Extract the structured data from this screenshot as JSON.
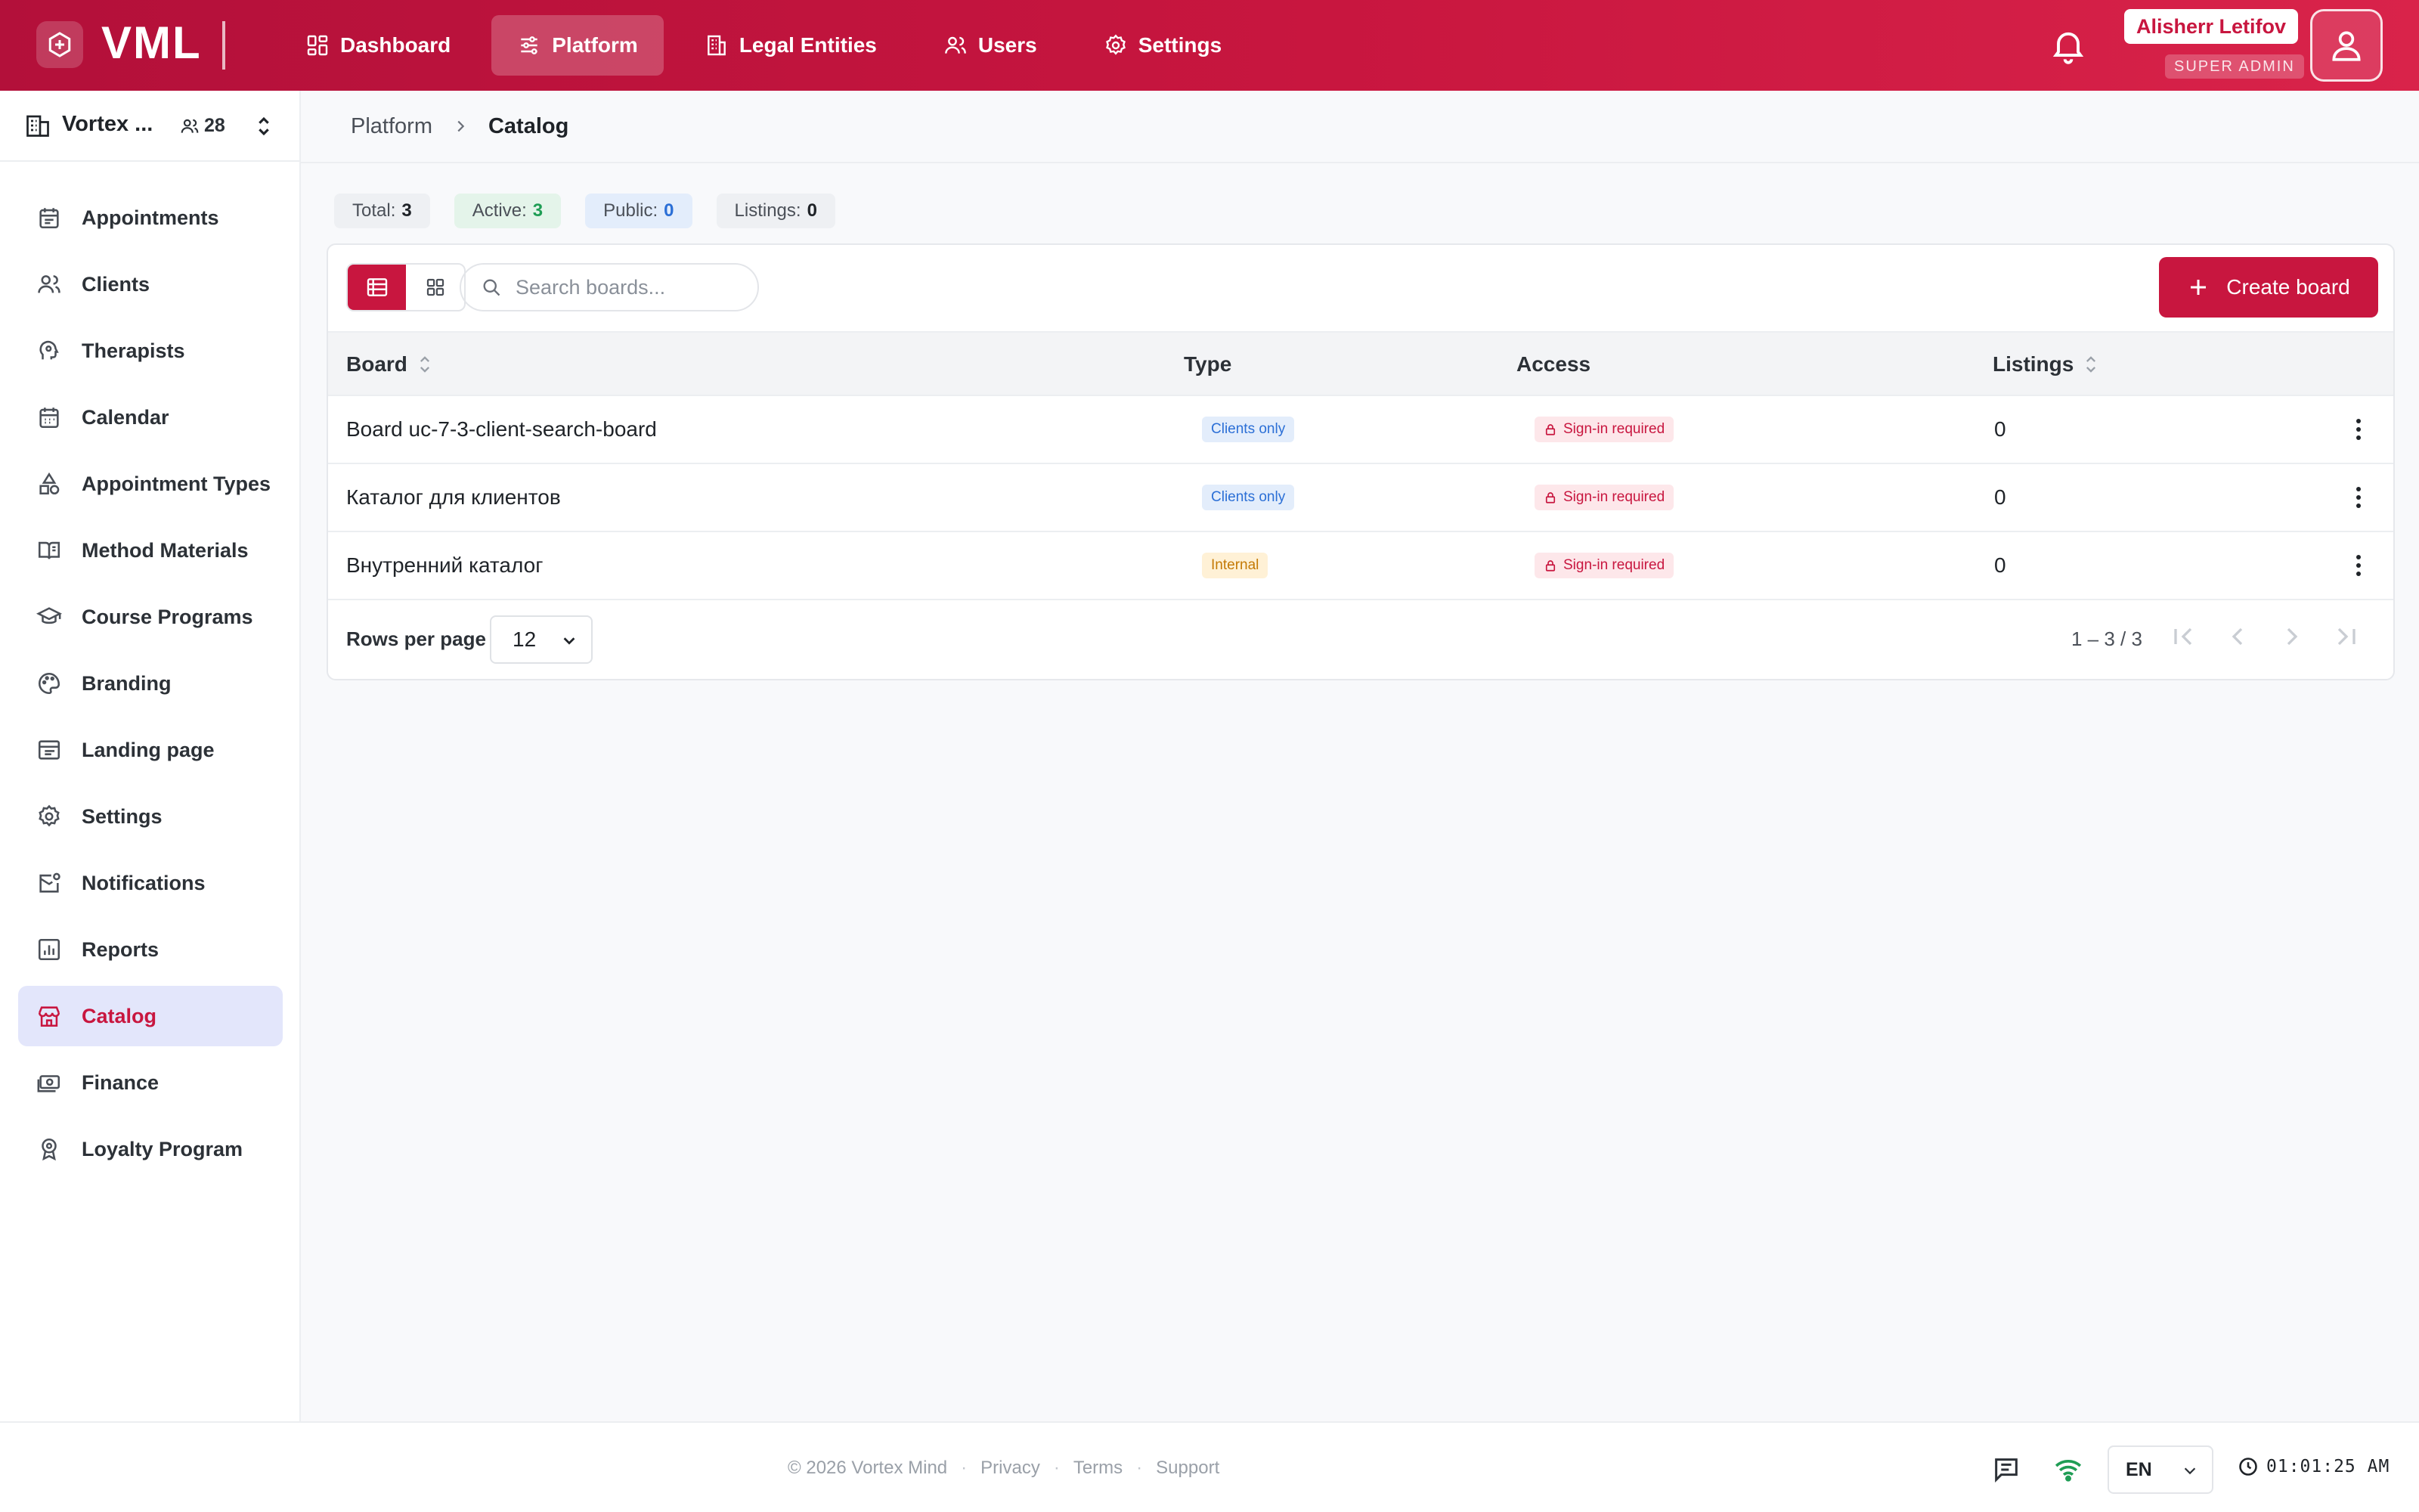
{
  "app": {
    "logo_text": "VML"
  },
  "nav": [
    {
      "label": "Dashboard",
      "icon": "dashboard-icon",
      "active": false
    },
    {
      "label": "Platform",
      "icon": "sliders-icon",
      "active": true
    },
    {
      "label": "Legal Entities",
      "icon": "building-icon",
      "active": false
    },
    {
      "label": "Users",
      "icon": "users-icon",
      "active": false
    },
    {
      "label": "Settings",
      "icon": "gear-icon",
      "active": false
    }
  ],
  "user": {
    "name": "Alisherr Letifov",
    "role": "SUPER ADMIN"
  },
  "org": {
    "name": "Vortex ...",
    "member_count": "28"
  },
  "sidebar": {
    "items": [
      {
        "label": "Appointments",
        "icon": "calendar-list-icon",
        "active": false
      },
      {
        "label": "Clients",
        "icon": "users-icon",
        "active": false
      },
      {
        "label": "Therapists",
        "icon": "head-icon",
        "active": false
      },
      {
        "label": "Calendar",
        "icon": "calendar-icon",
        "active": false
      },
      {
        "label": "Appointment Types",
        "icon": "shapes-icon",
        "active": false
      },
      {
        "label": "Method Materials",
        "icon": "book-icon",
        "active": false
      },
      {
        "label": "Course Programs",
        "icon": "graduation-cap-icon",
        "active": false
      },
      {
        "label": "Branding",
        "icon": "palette-icon",
        "active": false
      },
      {
        "label": "Landing page",
        "icon": "layout-icon",
        "active": false
      },
      {
        "label": "Settings",
        "icon": "gear-icon",
        "active": false
      },
      {
        "label": "Notifications",
        "icon": "mail-bell-icon",
        "active": false
      },
      {
        "label": "Reports",
        "icon": "bar-chart-icon",
        "active": false
      },
      {
        "label": "Catalog",
        "icon": "store-icon",
        "active": true
      },
      {
        "label": "Finance",
        "icon": "cash-icon",
        "active": false
      },
      {
        "label": "Loyalty Program",
        "icon": "badge-icon",
        "active": false
      }
    ]
  },
  "breadcrumb": {
    "parent": "Platform",
    "current": "Catalog"
  },
  "stats": [
    {
      "label": "Total:",
      "value": "3",
      "kind": "total"
    },
    {
      "label": "Active:",
      "value": "3",
      "kind": "active"
    },
    {
      "label": "Public:",
      "value": "0",
      "kind": "public"
    },
    {
      "label": "Listings:",
      "value": "0",
      "kind": "listings"
    }
  ],
  "toolbar": {
    "search_placeholder": "Search boards...",
    "create_label": "Create board",
    "view_mode": "list"
  },
  "table": {
    "columns": {
      "board": "Board",
      "type": "Type",
      "access": "Access",
      "listings": "Listings"
    },
    "rows": [
      {
        "board": "Board uc-7-3-client-search-board",
        "type": "Clients only",
        "type_kind": "clients",
        "access": "Sign-in required",
        "listings": "0"
      },
      {
        "board": "Каталог для клиентов",
        "type": "Clients only",
        "type_kind": "clients",
        "access": "Sign-in required",
        "listings": "0"
      },
      {
        "board": "Внутренний каталог",
        "type": "Internal",
        "type_kind": "internal",
        "access": "Sign-in required",
        "listings": "0"
      }
    ]
  },
  "pagination": {
    "rows_per_page_label": "Rows per page",
    "rows_per_page": "12",
    "range": "1 – 3 / 3"
  },
  "footer": {
    "copyright": "© 2026 Vortex Mind",
    "links": [
      "Privacy",
      "Terms",
      "Support"
    ],
    "language": "EN",
    "time": "01:01:25 AM"
  },
  "colors": {
    "brand": "#c8163f",
    "success": "#1f9d55",
    "info": "#2b6fd6",
    "warning": "#c47a06"
  }
}
